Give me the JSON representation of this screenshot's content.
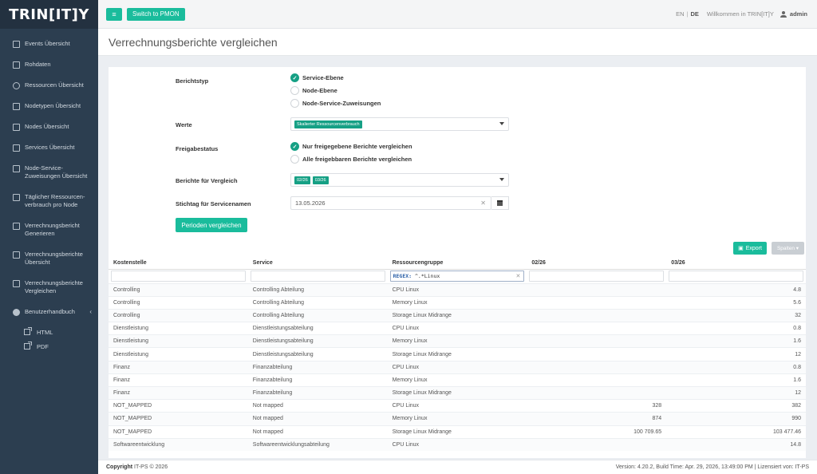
{
  "app": {
    "logo": "TRIN[IT]Y"
  },
  "topbar": {
    "switch_label": "Switch to PMON",
    "lang_en": "EN",
    "lang_sep": "|",
    "lang_de": "DE",
    "welcome": "Willkommen in TRIN[IT]Y",
    "user": "admin"
  },
  "sidebar": {
    "items": [
      {
        "label": "Events Übersicht",
        "icon": "calendar-icon"
      },
      {
        "label": "Rohdaten",
        "icon": "database-icon"
      },
      {
        "label": "Ressourcen Übersicht",
        "icon": "globe-icon"
      },
      {
        "label": "Nodetypen Übersicht",
        "icon": "nodetypes-icon"
      },
      {
        "label": "Nodes Übersicht",
        "icon": "nodes-icon"
      },
      {
        "label": "Services Übersicht",
        "icon": "services-icon"
      },
      {
        "label": "Node-Service-Zuweisungen Übersicht",
        "icon": "sitemap-icon"
      },
      {
        "label": "Täglicher Ressourcen-verbrauch pro Node",
        "icon": "bar-chart-icon"
      },
      {
        "label": "Verrechnungsbericht Generieren",
        "icon": "report-icon"
      },
      {
        "label": "Verrechnungsberichte Übersicht",
        "icon": "file-icon"
      },
      {
        "label": "Verrechnungsberichte Vergleichen",
        "icon": "compare-icon"
      }
    ],
    "handbook": {
      "label": "Benutzerhandbuch",
      "html": "HTML",
      "pdf": "PDF"
    }
  },
  "page": {
    "title": "Verrechnungsberichte vergleichen"
  },
  "form": {
    "berichtstyp_label": "Berichtstyp",
    "berichtstyp_options": [
      "Service-Ebene",
      "Node-Ebene",
      "Node-Service-Zuweisungen"
    ],
    "werte_label": "Werte",
    "werte_chip": "Skalierter Ressourcenverbrauch",
    "freigabe_label": "Freigabestatus",
    "freigabe_options": [
      "Nur freigegebene Berichte vergleichen",
      "Alle freigebbaren Berichte vergleichen"
    ],
    "berichte_label": "Berichte für Vergleich",
    "berichte_chips": [
      "02/26",
      "03/26"
    ],
    "stichtag_label": "Stichtag für Servicenamen",
    "stichtag_value": "13.05.2026",
    "compare_button": "Perioden vergleichen"
  },
  "table": {
    "export_label": "Export",
    "spalten_label": "Spalten ▾",
    "headers": [
      "Kostenstelle",
      "Service",
      "Ressourcengruppe",
      "02/26",
      "03/26"
    ],
    "filter_regex_prefix": "REGEX:",
    "filter_regex_value": " ^.*Linux",
    "rows": [
      [
        "Controlling",
        "Controlling Abteilung",
        "CPU Linux",
        "",
        "4.8"
      ],
      [
        "Controlling",
        "Controlling Abteilung",
        "Memory Linux",
        "",
        "5.6"
      ],
      [
        "Controlling",
        "Controlling Abteilung",
        "Storage Linux Midrange",
        "",
        "32"
      ],
      [
        "Dienstleistung",
        "Dienstleistungsabteilung",
        "CPU Linux",
        "",
        "0.8"
      ],
      [
        "Dienstleistung",
        "Dienstleistungsabteilung",
        "Memory Linux",
        "",
        "1.6"
      ],
      [
        "Dienstleistung",
        "Dienstleistungsabteilung",
        "Storage Linux Midrange",
        "",
        "12"
      ],
      [
        "Finanz",
        "Finanzabteilung",
        "CPU Linux",
        "",
        "0.8"
      ],
      [
        "Finanz",
        "Finanzabteilung",
        "Memory Linux",
        "",
        "1.6"
      ],
      [
        "Finanz",
        "Finanzabteilung",
        "Storage Linux Midrange",
        "",
        "12"
      ],
      [
        "NOT_MAPPED",
        "Not mapped",
        "CPU Linux",
        "328",
        "382"
      ],
      [
        "NOT_MAPPED",
        "Not mapped",
        "Memory Linux",
        "874",
        "990"
      ],
      [
        "NOT_MAPPED",
        "Not mapped",
        "Storage Linux Midrange",
        "100 709.65",
        "103 477.46"
      ],
      [
        "Softwareentwicklung",
        "Softwareentwicklungsabteilung",
        "CPU Linux",
        "",
        "14.8"
      ]
    ]
  },
  "footer": {
    "copyright_label": "Copyright",
    "copyright_text": "IT-PS © 2026",
    "version": "Version: 4.20.2, Build Time: Apr. 29, 2026, 13:49:00 PM | Lizensiert von: IT-PS"
  }
}
